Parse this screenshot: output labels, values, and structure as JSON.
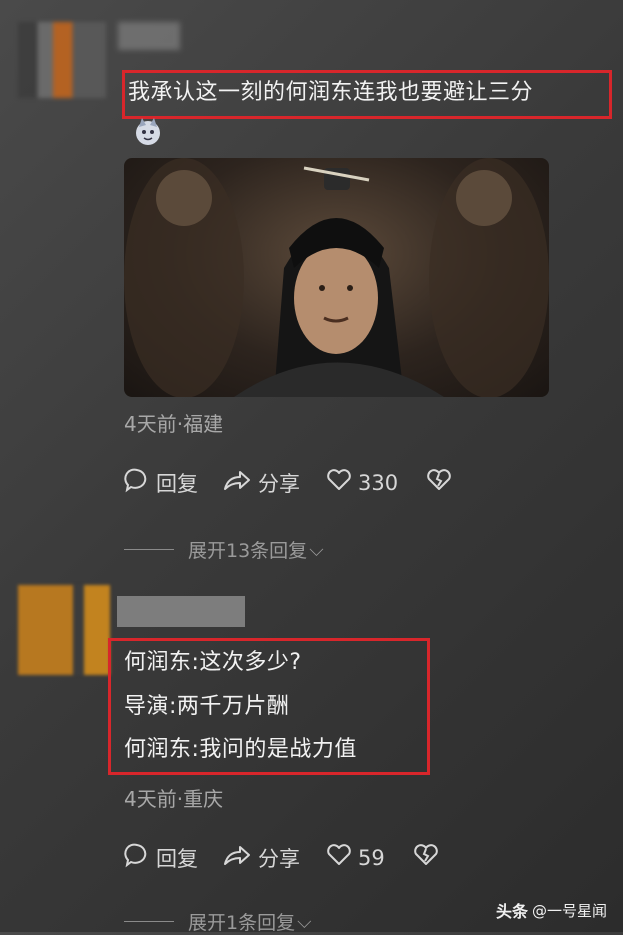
{
  "comment1": {
    "text": "我承认这一刻的何润东连我也要避让三分",
    "meta": "4天前·福建",
    "reply_label": "回复",
    "share_label": "分享",
    "like_count": "330",
    "expand_label": "展开13条回复"
  },
  "comment2": {
    "lines": [
      "何润东:这次多少?",
      "导演:两千万片酬",
      "何润东:我问的是战力值"
    ],
    "meta": "4天前·重庆",
    "reply_label": "回复",
    "share_label": "分享",
    "like_count": "59",
    "expand_label": "展开1条回复"
  },
  "watermark": {
    "brand": "头条",
    "handle": "@一号星闻"
  },
  "colors": {
    "highlight_border": "#d8262b",
    "background": "#3a3a3a"
  }
}
